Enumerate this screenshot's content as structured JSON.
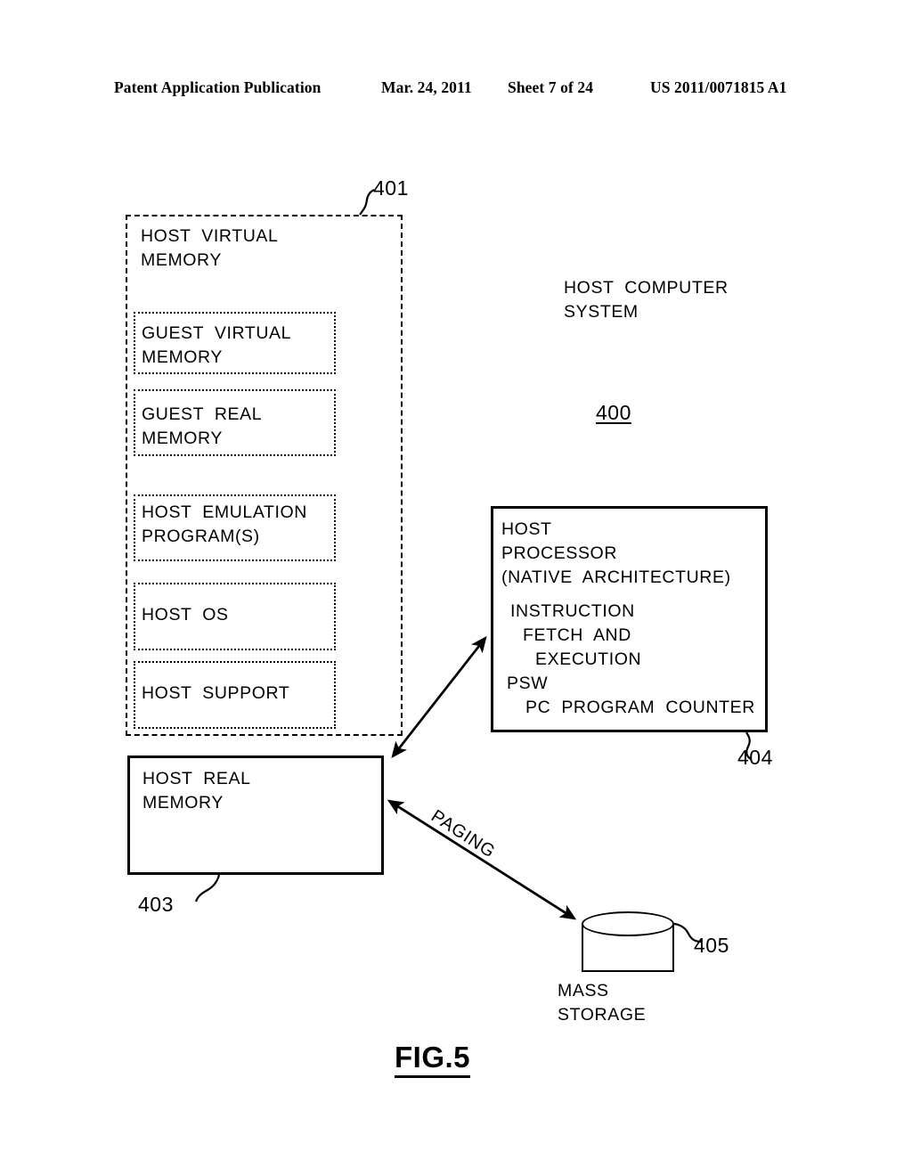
{
  "header": {
    "publication": "Patent Application Publication",
    "date": "Mar. 24, 2011",
    "sheet": "Sheet 7 of 24",
    "number": "US 2011/0071815 A1"
  },
  "figure": {
    "caption": "FIG.5"
  },
  "diagram": {
    "system_label": "HOST  COMPUTER\nSYSTEM",
    "system_ref": "400",
    "virtual_memory": {
      "title": "HOST  VIRTUAL\nMEMORY",
      "ref": "401",
      "blocks": [
        {
          "label": "GUEST  VIRTUAL\nMEMORY"
        },
        {
          "label": "GUEST  REAL\nMEMORY"
        },
        {
          "label": "HOST  EMULATION\nPROGRAM(S)"
        },
        {
          "label": "HOST  OS"
        },
        {
          "label": "HOST  SUPPORT"
        }
      ]
    },
    "real_memory": {
      "label": "HOST  REAL\nMEMORY",
      "ref": "403"
    },
    "processor": {
      "line1": "HOST",
      "line2": "PROCESSOR",
      "line3": "(NATIVE  ARCHITECTURE)",
      "line4": "INSTRUCTION",
      "line5": "FETCH  AND",
      "line6": "EXECUTION",
      "line7": "PSW",
      "line8": "PC  PROGRAM  COUNTER",
      "ref": "404"
    },
    "mass_storage": {
      "label": "MASS\nSTORAGE",
      "ref": "405"
    },
    "paging_label": "PAGING"
  }
}
